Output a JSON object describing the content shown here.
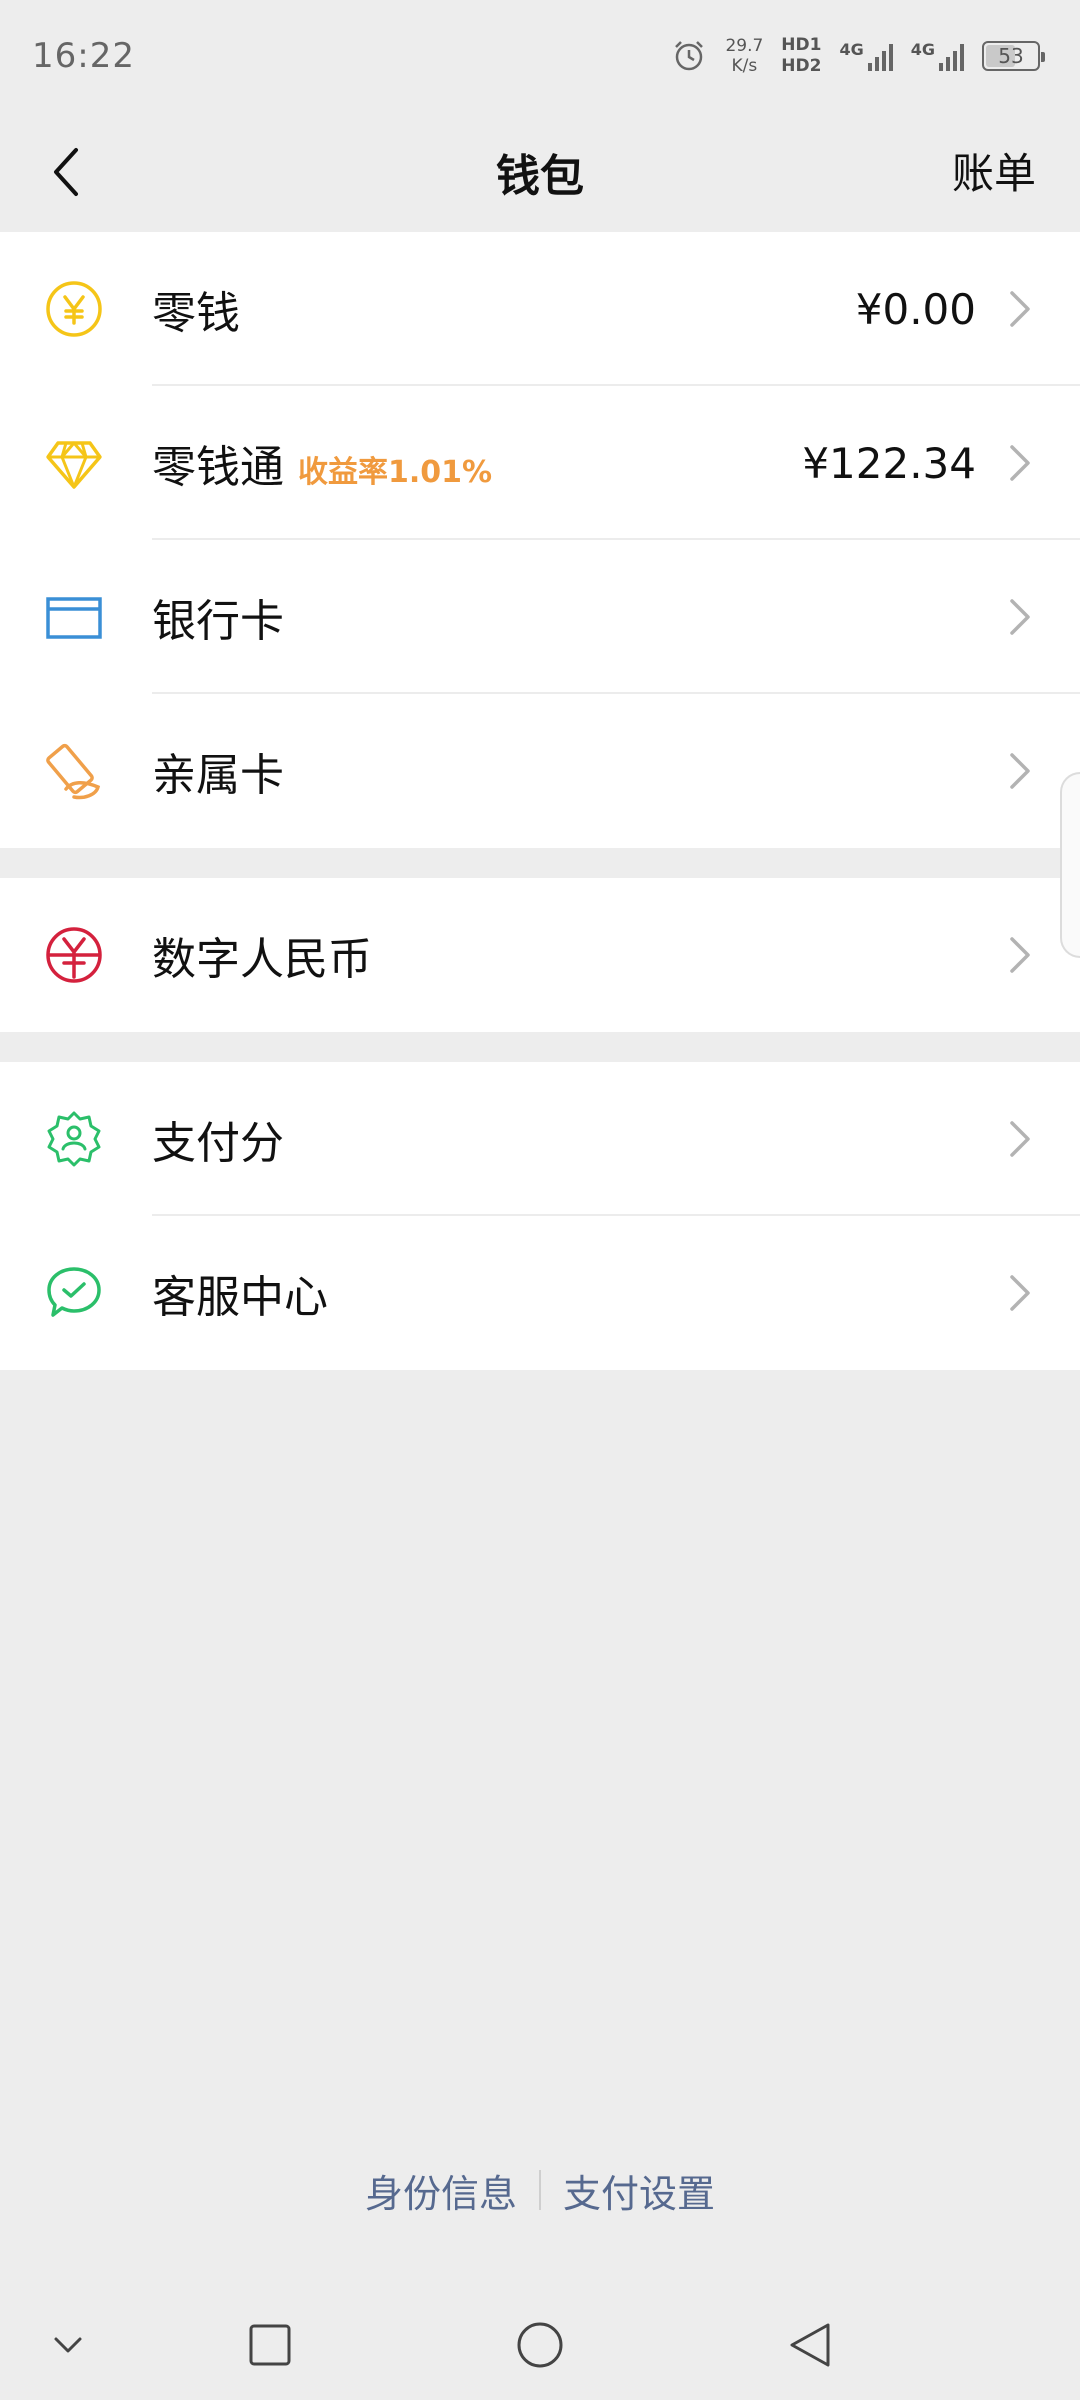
{
  "status_bar": {
    "time": "16:22",
    "speed_value": "29.7",
    "speed_unit": "K/s",
    "hd1": "HD1",
    "hd2": "HD2",
    "net1": "4G",
    "net2": "4G",
    "battery": "53"
  },
  "nav": {
    "title": "钱包",
    "right": "账单"
  },
  "groups": [
    {
      "items": [
        {
          "label": "零钱",
          "value": "¥0.00",
          "icon": "yuan-coin-icon"
        },
        {
          "label": "零钱通",
          "tag": "收益率1.01%",
          "value": "¥122.34",
          "icon": "diamond-icon"
        },
        {
          "label": "银行卡",
          "icon": "bank-card-icon"
        },
        {
          "label": "亲属卡",
          "icon": "family-card-icon"
        }
      ]
    },
    {
      "items": [
        {
          "label": "数字人民币",
          "icon": "digital-rmb-icon"
        }
      ]
    },
    {
      "items": [
        {
          "label": "支付分",
          "icon": "pay-score-icon"
        },
        {
          "label": "客服中心",
          "icon": "customer-service-icon"
        }
      ]
    }
  ],
  "footer": {
    "link1": "身份信息",
    "link2": "支付设置"
  },
  "colors": {
    "accent_orange": "#f09a3e",
    "link_blue": "#56698f",
    "yellow": "#f5c518",
    "blue": "#3a8fd6",
    "red": "#d4213d",
    "green": "#2bbf6a"
  }
}
